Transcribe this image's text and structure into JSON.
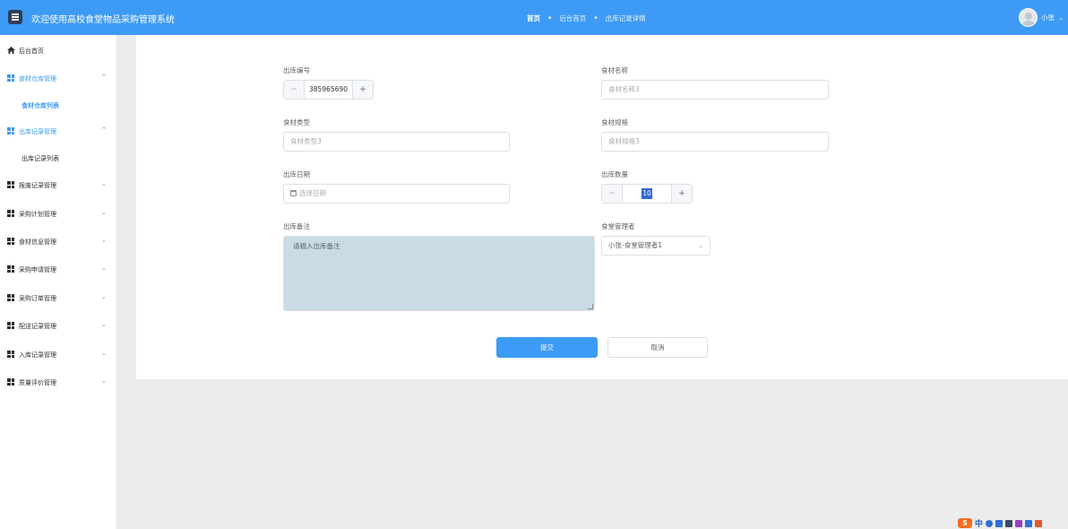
{
  "header": {
    "app_title": "欢迎使用高校食堂物品采购管理系统",
    "breadcrumbs": [
      "首页",
      "后台首页",
      "出库记录详情"
    ],
    "user_name": "小张"
  },
  "sidebar": {
    "home": "后台首页",
    "groups": [
      {
        "label": "食材仓库管理",
        "expanded": true
      },
      {
        "label": "出库记录管理",
        "expanded": true
      },
      {
        "label": "报废记录管理"
      },
      {
        "label": "采购计划管理"
      },
      {
        "label": "食材信息管理"
      },
      {
        "label": "采购申请管理"
      },
      {
        "label": "采购订单管理"
      },
      {
        "label": "配送记录管理"
      },
      {
        "label": "入库记录管理"
      },
      {
        "label": "质量评价管理"
      }
    ],
    "sub_items": {
      "food_warehouse_list": "食材仓库列表",
      "outbound_record_list": "出库记录列表"
    }
  },
  "form": {
    "outbound_no": {
      "label": "出库编号",
      "value": "385965690"
    },
    "food_name": {
      "label": "食材名称",
      "placeholder": "食材名称3"
    },
    "food_type": {
      "label": "食材类型",
      "placeholder": "食材类型3"
    },
    "food_spec": {
      "label": "食材规格",
      "placeholder": "食材规格3"
    },
    "outbound_date": {
      "label": "出库日期",
      "placeholder": "选择日期"
    },
    "outbound_qty": {
      "label": "出库数量",
      "value": "10"
    },
    "outbound_remark": {
      "label": "出库备注",
      "placeholder": "请输入出库备注"
    },
    "canteen_manager": {
      "label": "食堂管理者",
      "value": "小张-食堂管理者1"
    },
    "submit_label": "提交",
    "cancel_label": "取消"
  },
  "tray": {
    "ime_mode": "中",
    "ime_logo": "S"
  },
  "colors": {
    "primary": "#3d9bf5",
    "header_bg": "#3d9bf5",
    "page_bg": "#ececec",
    "textarea_bg": "#c9dce6"
  }
}
